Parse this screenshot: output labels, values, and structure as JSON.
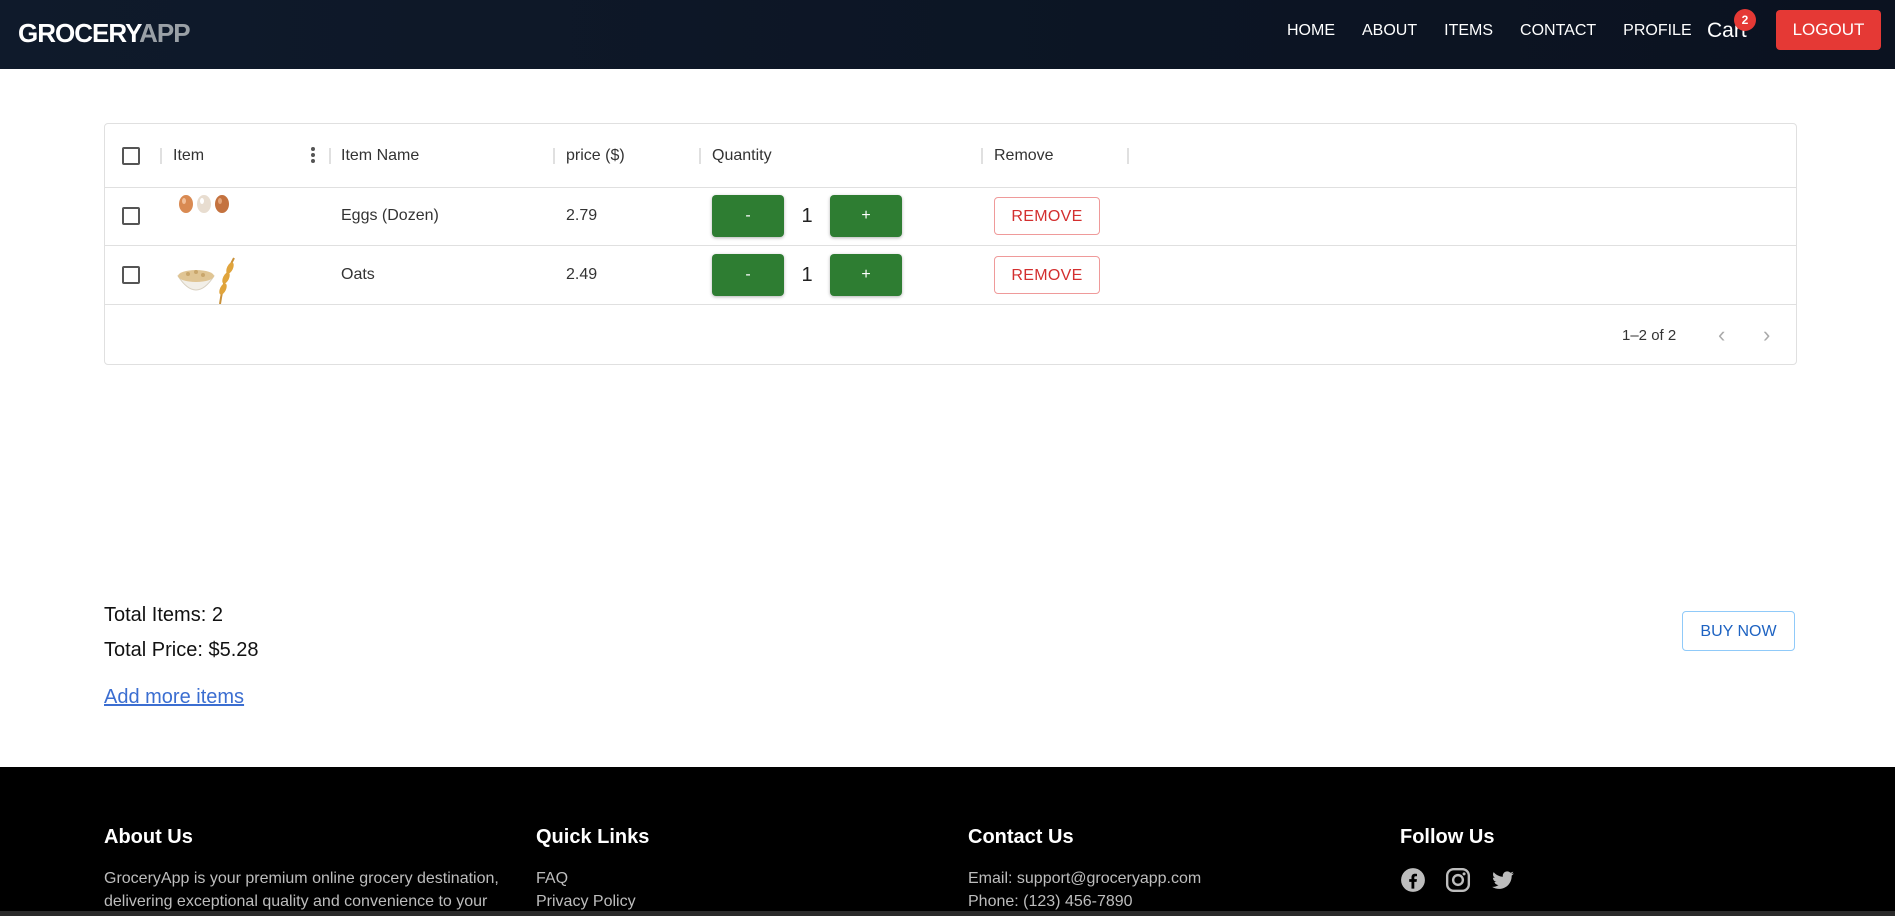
{
  "nav": {
    "brand_part1": "GROCERY",
    "brand_part2": "APP",
    "links": [
      "HOME",
      "ABOUT",
      "ITEMS",
      "CONTACT",
      "PROFILE"
    ],
    "cart_label": "Cart",
    "cart_count": "2",
    "logout_label": "LOGOUT"
  },
  "grid": {
    "columns": [
      "Item",
      "Item Name",
      "price ($)",
      "Quantity",
      "Remove"
    ],
    "rows": [
      {
        "image": "eggs-image",
        "name": "Eggs (Dozen)",
        "price": "2.79",
        "minus": "-",
        "quantity": "1",
        "plus": "+",
        "remove": "REMOVE"
      },
      {
        "image": "oats-image",
        "name": "Oats",
        "price": "2.49",
        "minus": "-",
        "quantity": "1",
        "plus": "+",
        "remove": "REMOVE"
      }
    ],
    "pagination": "1–2 of 2"
  },
  "summary": {
    "total_items": "Total Items: 2",
    "total_price": "Total Price: $5.28",
    "add_more": "Add more items",
    "buy_now": "BUY NOW"
  },
  "footer": {
    "about_title": "About Us",
    "about_text": "GroceryApp is your premium online grocery destination, delivering exceptional quality and convenience to your",
    "links_title": "Quick Links",
    "links": [
      "FAQ",
      "Privacy Policy"
    ],
    "contact_title": "Contact Us",
    "contact_email": "Email: support@groceryapp.com",
    "contact_phone": "Phone: (123) 456-7890",
    "follow_title": "Follow Us",
    "social_icons": [
      "facebook-icon",
      "instagram-icon",
      "twitter-icon"
    ]
  },
  "colors": {
    "nav_bg": "#0f1a2b",
    "accent_red": "#e53935",
    "button_green": "#2e7d32",
    "link_blue": "#3b6ed1",
    "footer_bg": "#000000"
  }
}
